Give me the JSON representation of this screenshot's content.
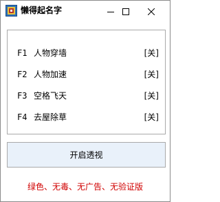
{
  "window": {
    "title": "懒得起名字"
  },
  "icons": {
    "app": "app-logo-icon",
    "minimize": "minimize-icon",
    "maximize": "maximize-icon",
    "close": "close-icon"
  },
  "colors": {
    "button_bg": "#e9f1fa",
    "footer_text": "#d00000"
  },
  "hotkeys": [
    {
      "key": "F1",
      "name": "人物穿墙",
      "state": "[关]"
    },
    {
      "key": "F2",
      "name": "人物加速",
      "state": "[关]"
    },
    {
      "key": "F3",
      "name": "空格飞天",
      "state": "[关]"
    },
    {
      "key": "F4",
      "name": "去屋除草",
      "state": "[关]"
    }
  ],
  "main_button": {
    "label": "开启透视"
  },
  "footer": {
    "text": "绿色、无毒、无广告、无验证版"
  }
}
